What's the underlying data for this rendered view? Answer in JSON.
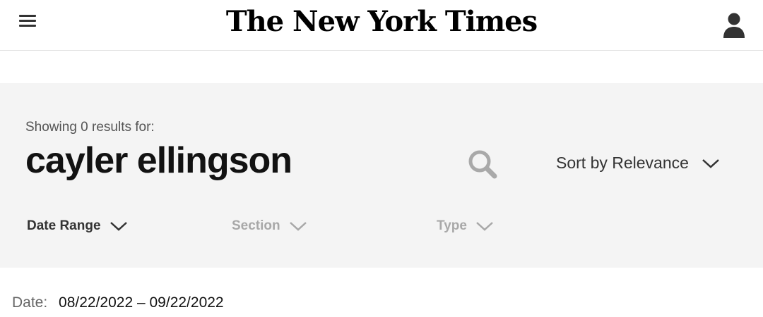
{
  "header": {
    "logo_text": "The New York Times",
    "menu_icon": "hamburger-menu-icon",
    "user_icon": "user-account-icon"
  },
  "search": {
    "showing_text": "Showing 0 results for:",
    "query": "cayler ellingson",
    "search_icon": "magnifier-icon",
    "sort_label": "Sort by Relevance"
  },
  "filters": {
    "date_range": "Date Range",
    "section": "Section",
    "type": "Type"
  },
  "date_filter": {
    "label": "Date:",
    "value": "08/22/2022 – 09/22/2022"
  },
  "colors": {
    "panel_bg": "#f4f4f4",
    "text_primary": "#121212",
    "text_muted": "#a8a8a8"
  }
}
